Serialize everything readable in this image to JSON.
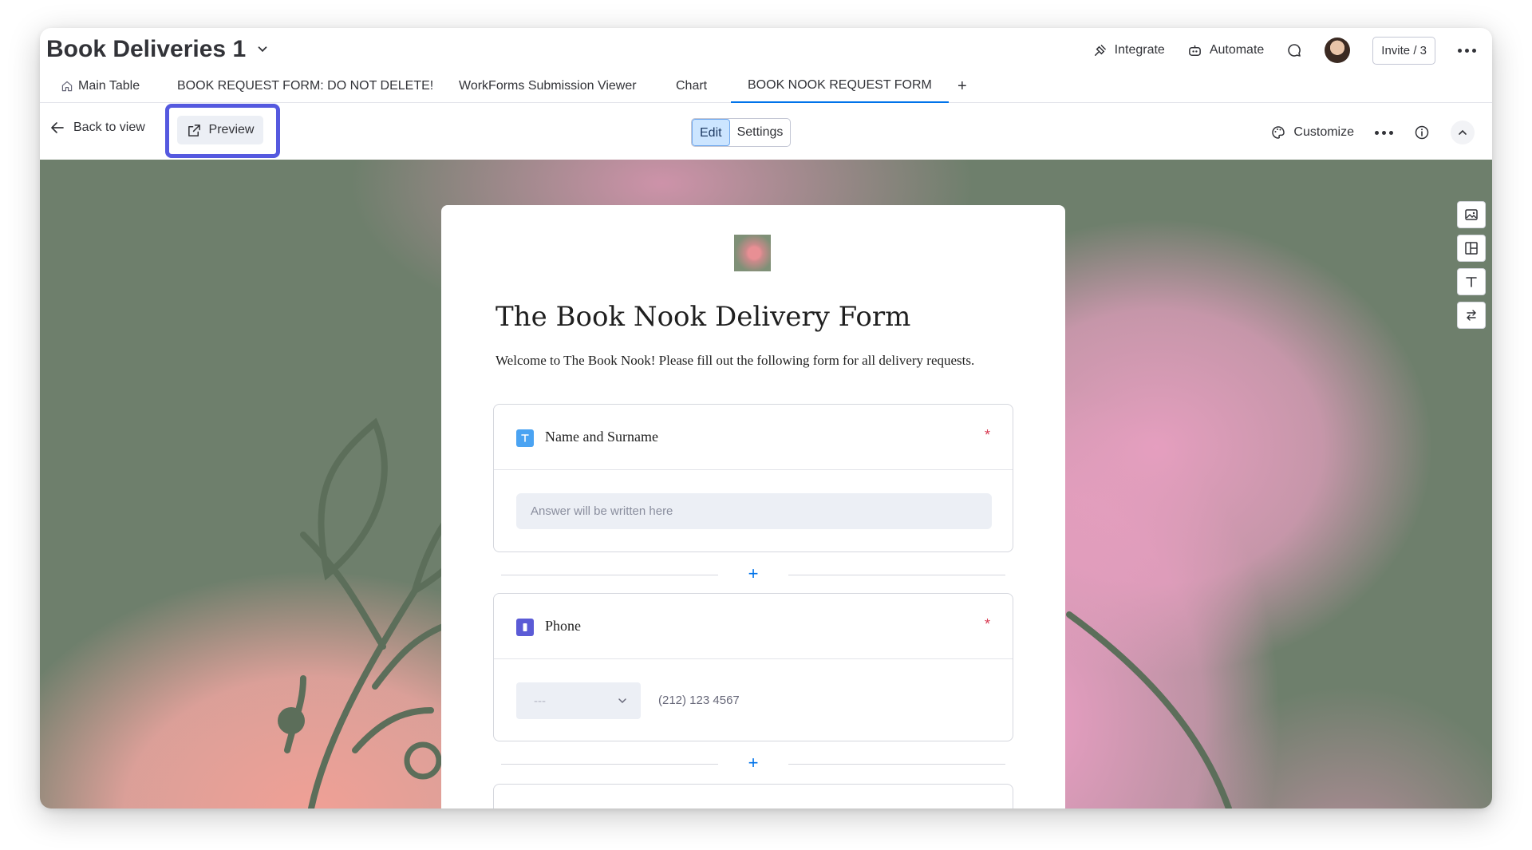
{
  "board": {
    "title": "Book Deliveries 1"
  },
  "header": {
    "integrate_label": "Integrate",
    "automate_label": "Automate",
    "invite_label": "Invite / 3"
  },
  "tabs": [
    {
      "label": "Main Table"
    },
    {
      "label": "BOOK REQUEST FORM: DO NOT DELETE!"
    },
    {
      "label": "WorkForms Submission Viewer"
    },
    {
      "label": "Chart"
    },
    {
      "label": "BOOK NOOK REQUEST FORM"
    },
    {
      "label": "+"
    }
  ],
  "toolbar": {
    "back_label": "Back to view",
    "preview_label": "Preview",
    "edit_label": "Edit",
    "settings_label": "Settings",
    "customize_label": "Customize"
  },
  "form": {
    "title": "The Book Nook Delivery Form",
    "description": "Welcome to The Book Nook! Please fill out the following form for all delivery requests.",
    "questions": [
      {
        "label": "Name and Surname",
        "required_mark": "*",
        "placeholder": "Answer will be written here"
      },
      {
        "label": "Phone",
        "required_mark": "*",
        "country_value": "---",
        "phone_placeholder": "(212) 123 4567"
      }
    ],
    "add_label": "+"
  },
  "colors": {
    "accent": "#0073ea",
    "highlight": "#5559df",
    "required": "#d83a52",
    "text_icon": "#4aa3f2",
    "phone_icon": "#5b5bd6"
  }
}
